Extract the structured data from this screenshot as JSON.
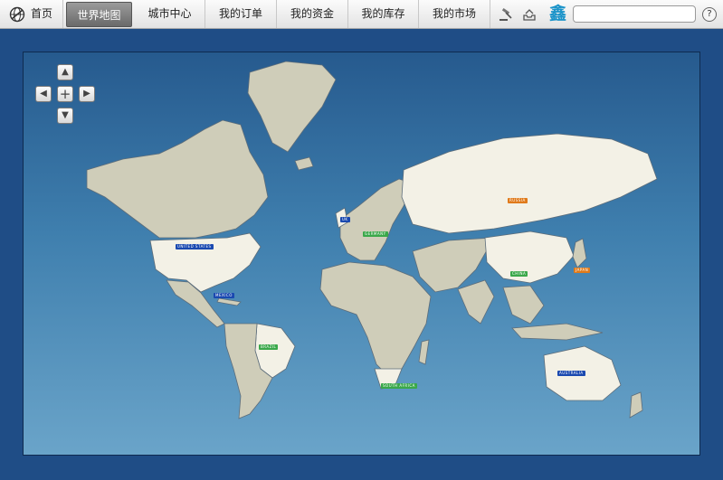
{
  "nav": {
    "home_label": "首页",
    "items": [
      "世界地图",
      "城市中心",
      "我的订单",
      "我的资金",
      "我的库存",
      "我的市场"
    ],
    "active_index": 0
  },
  "toolbar": {
    "auction_icon": "gavel-icon",
    "mail_icon": "inbox-icon",
    "brand_glyph": "鑫",
    "search_placeholder": "",
    "help_glyph": "?"
  },
  "pan_controls": {
    "up": "▲",
    "left": "◀",
    "zoom_in": "+",
    "right": "▶",
    "down": "▼"
  },
  "map": {
    "ocean_labels": [],
    "country_badges": [
      {
        "name": "RUSSIA",
        "color": "#e07a1a"
      },
      {
        "name": "UNITED STATES",
        "color": "#1a49b0"
      },
      {
        "name": "CHINA",
        "color": "#3aa84a"
      },
      {
        "name": "JAPAN",
        "color": "#e07a1a"
      },
      {
        "name": "BRAZIL",
        "color": "#3aa84a"
      },
      {
        "name": "AUSTRALIA",
        "color": "#1a49b0"
      },
      {
        "name": "SOUTH AFRICA",
        "color": "#3aa84a"
      },
      {
        "name": "UK",
        "color": "#1a49b0"
      },
      {
        "name": "GERMANY",
        "color": "#3aa84a"
      },
      {
        "name": "MEXICO",
        "color": "#1a49b0"
      }
    ],
    "colors": {
      "ocean_top": "#265a8e",
      "ocean_bottom": "#6aa4c9",
      "land_highlight": "#f3f1e6",
      "land_neutral": "#cfcdb9"
    }
  }
}
